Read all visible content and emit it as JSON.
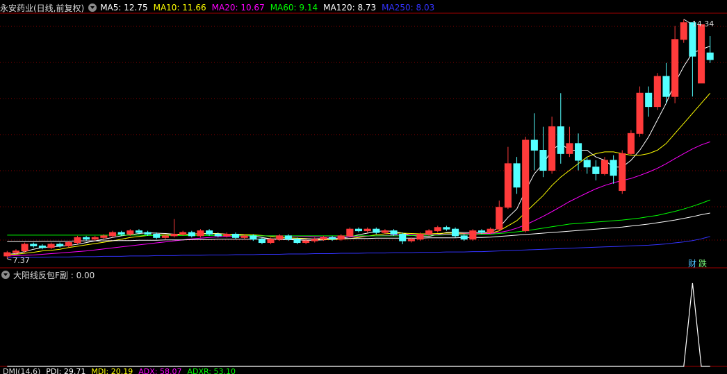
{
  "header": {
    "title": "永安药业(日线,前复权)",
    "ma": [
      {
        "label": "MA5: 12.75",
        "color": "#ffffff"
      },
      {
        "label": "MA10: 11.66",
        "color": "#ffff00"
      },
      {
        "label": "MA20: 10.67",
        "color": "#ff00ff"
      },
      {
        "label": "MA60: 9.14",
        "color": "#00ff00"
      },
      {
        "label": "MA120: 8.73",
        "color": "#ffffff"
      },
      {
        "label": "MA250: 8.03",
        "color": "#3333ff"
      }
    ]
  },
  "sub_header": {
    "title": "大阳线反包F副 : 0.00"
  },
  "bottom_header": {
    "labels": [
      "DMI(14,6)",
      "PDI: 29.71",
      "MDI: 20.19",
      "ADX: 58.07",
      "ADXR: 53.10"
    ]
  },
  "badges": {
    "cai": "财",
    "die": "跌"
  },
  "colors": {
    "up": "#ff3b3b",
    "down": "#54ffff",
    "grid": "#8b0000",
    "border": "#a00000"
  },
  "chart_data": [
    {
      "type": "candlestick",
      "title": "永安药业(日线,前复权)",
      "price_range": [
        7.2,
        14.6
      ],
      "high_label": "14.34",
      "low_label": "7.37",
      "candles": [
        [
          7.45,
          7.55,
          7.37,
          7.6
        ],
        [
          7.55,
          7.6,
          7.5,
          7.65
        ],
        [
          7.6,
          7.8,
          7.55,
          7.85
        ],
        [
          7.8,
          7.75,
          7.7,
          7.85
        ],
        [
          7.75,
          7.7,
          7.65,
          7.8
        ],
        [
          7.7,
          7.8,
          7.65,
          7.85
        ],
        [
          7.8,
          7.75,
          7.7,
          7.85
        ],
        [
          7.75,
          7.85,
          7.7,
          7.9
        ],
        [
          7.85,
          8.0,
          7.8,
          8.05
        ],
        [
          8.0,
          7.95,
          7.9,
          8.05
        ],
        [
          7.95,
          8.0,
          7.9,
          8.05
        ],
        [
          8.0,
          8.05,
          7.95,
          8.1
        ],
        [
          8.05,
          8.15,
          8.0,
          8.2
        ],
        [
          8.15,
          8.1,
          8.05,
          8.2
        ],
        [
          8.1,
          8.2,
          8.05,
          8.25
        ],
        [
          8.2,
          8.15,
          8.1,
          8.25
        ],
        [
          8.15,
          8.1,
          8.05,
          8.2
        ],
        [
          8.1,
          8.0,
          7.95,
          8.15
        ],
        [
          8.0,
          8.05,
          7.95,
          8.1
        ],
        [
          8.05,
          8.1,
          8.0,
          8.55
        ],
        [
          8.1,
          8.15,
          8.05,
          8.2
        ],
        [
          8.15,
          8.05,
          8.0,
          8.2
        ],
        [
          8.05,
          8.2,
          8.0,
          8.25
        ],
        [
          8.2,
          8.1,
          8.05,
          8.25
        ],
        [
          8.1,
          8.05,
          8.0,
          8.15
        ],
        [
          8.05,
          8.1,
          8.0,
          8.15
        ],
        [
          8.1,
          8.0,
          7.95,
          8.15
        ],
        [
          8.0,
          8.05,
          7.95,
          8.1
        ],
        [
          8.05,
          7.95,
          7.9,
          8.1
        ],
        [
          7.95,
          7.85,
          7.8,
          8.0
        ],
        [
          7.85,
          7.95,
          7.8,
          8.0
        ],
        [
          7.95,
          8.05,
          7.9,
          8.1
        ],
        [
          8.05,
          7.95,
          7.9,
          8.1
        ],
        [
          7.95,
          7.85,
          7.8,
          8.0
        ],
        [
          7.85,
          7.9,
          7.8,
          7.95
        ],
        [
          7.9,
          7.95,
          7.85,
          8.0
        ],
        [
          7.95,
          8.0,
          7.9,
          8.05
        ],
        [
          8.0,
          7.95,
          7.9,
          8.05
        ],
        [
          7.95,
          8.05,
          7.9,
          8.1
        ],
        [
          8.05,
          8.25,
          8.0,
          8.3
        ],
        [
          8.25,
          8.2,
          8.15,
          8.3
        ],
        [
          8.2,
          8.25,
          8.15,
          8.3
        ],
        [
          8.25,
          8.15,
          8.1,
          8.3
        ],
        [
          8.15,
          8.2,
          8.1,
          8.25
        ],
        [
          8.2,
          8.1,
          8.05,
          8.25
        ],
        [
          8.1,
          7.9,
          7.8,
          8.15
        ],
        [
          7.9,
          7.95,
          7.85,
          8.0
        ],
        [
          7.95,
          8.1,
          7.9,
          8.15
        ],
        [
          8.1,
          8.2,
          8.05,
          8.25
        ],
        [
          8.2,
          8.3,
          8.15,
          8.35
        ],
        [
          8.3,
          8.25,
          8.2,
          8.35
        ],
        [
          8.25,
          8.05,
          8.0,
          8.3
        ],
        [
          8.05,
          7.95,
          7.9,
          8.1
        ],
        [
          7.95,
          8.2,
          7.9,
          8.25
        ],
        [
          8.2,
          8.15,
          8.1,
          8.25
        ],
        [
          8.15,
          8.25,
          8.1,
          8.3
        ],
        [
          8.25,
          8.9,
          8.2,
          9.1
        ],
        [
          8.9,
          10.2,
          8.85,
          10.7
        ],
        [
          10.2,
          9.5,
          9.3,
          10.4
        ],
        [
          8.2,
          10.9,
          8.15,
          11.0
        ],
        [
          10.9,
          10.6,
          10.0,
          11.7
        ],
        [
          10.6,
          10.0,
          9.8,
          11.3
        ],
        [
          10.0,
          11.3,
          9.9,
          11.6
        ],
        [
          11.3,
          10.5,
          10.2,
          12.3
        ],
        [
          10.5,
          10.8,
          10.4,
          11.3
        ],
        [
          10.8,
          10.3,
          10.0,
          11.1
        ],
        [
          10.3,
          10.1,
          9.9,
          10.4
        ],
        [
          10.1,
          9.9,
          9.7,
          10.3
        ],
        [
          9.9,
          10.3,
          9.85,
          10.4
        ],
        [
          10.3,
          9.85,
          9.6,
          10.45
        ],
        [
          9.4,
          10.5,
          9.3,
          10.6
        ],
        [
          10.5,
          11.1,
          10.45,
          11.2
        ],
        [
          11.1,
          12.3,
          11.0,
          12.5
        ],
        [
          12.3,
          11.9,
          11.6,
          12.5
        ],
        [
          11.9,
          12.8,
          11.8,
          12.9
        ],
        [
          12.8,
          12.2,
          12.0,
          13.2
        ],
        [
          12.2,
          13.9,
          12.0,
          14.3
        ],
        [
          13.9,
          14.4,
          13.8,
          14.5
        ],
        [
          14.4,
          13.4,
          12.2,
          13.8
        ],
        [
          12.6,
          14.34,
          12.6,
          14.34
        ],
        [
          13.5,
          13.3,
          13.2,
          14.0
        ]
      ],
      "ma": [
        {
          "name": "MA5",
          "color": "#ffffff",
          "values": [
            7.5,
            7.52,
            7.58,
            7.65,
            7.7,
            7.72,
            7.74,
            7.76,
            7.8,
            7.85,
            7.9,
            7.95,
            8.0,
            8.05,
            8.08,
            8.12,
            8.14,
            8.13,
            8.12,
            8.1,
            8.1,
            8.1,
            8.12,
            8.12,
            8.12,
            8.1,
            8.08,
            8.06,
            8.04,
            8.0,
            7.96,
            7.94,
            7.94,
            7.93,
            7.92,
            7.92,
            7.93,
            7.95,
            7.98,
            8.02,
            8.08,
            8.13,
            8.18,
            8.2,
            8.18,
            8.13,
            8.07,
            8.03,
            8.03,
            8.09,
            8.15,
            8.16,
            8.15,
            8.14,
            8.15,
            8.16,
            8.3,
            8.6,
            8.85,
            9.4,
            9.9,
            10.2,
            10.6,
            10.8,
            10.6,
            10.6,
            10.6,
            10.4,
            10.3,
            10.1,
            10.1,
            10.3,
            10.6,
            11.0,
            11.5,
            12.0,
            12.6,
            13.1,
            13.5,
            13.6,
            13.7
          ]
        },
        {
          "name": "MA10",
          "color": "#ffff00",
          "values": [
            7.5,
            7.5,
            7.53,
            7.56,
            7.6,
            7.62,
            7.65,
            7.7,
            7.74,
            7.78,
            7.82,
            7.86,
            7.9,
            7.95,
            8.0,
            8.03,
            8.06,
            8.07,
            8.08,
            8.08,
            8.09,
            8.1,
            8.11,
            8.11,
            8.11,
            8.1,
            8.1,
            8.09,
            8.08,
            8.06,
            8.03,
            8.0,
            7.99,
            7.98,
            7.97,
            7.95,
            7.94,
            7.94,
            7.95,
            7.97,
            8.0,
            8.04,
            8.08,
            8.11,
            8.13,
            8.13,
            8.12,
            8.11,
            8.11,
            8.12,
            8.13,
            8.13,
            8.12,
            8.11,
            8.12,
            8.13,
            8.2,
            8.35,
            8.5,
            8.75,
            9.0,
            9.25,
            9.55,
            9.8,
            10.0,
            10.2,
            10.4,
            10.5,
            10.55,
            10.55,
            10.5,
            10.45,
            10.45,
            10.5,
            10.6,
            10.8,
            11.1,
            11.4,
            11.7,
            12.0,
            12.3
          ]
        },
        {
          "name": "MA20",
          "color": "#ff00ff",
          "values": [
            7.45,
            7.46,
            7.47,
            7.48,
            7.5,
            7.52,
            7.54,
            7.56,
            7.58,
            7.6,
            7.63,
            7.66,
            7.69,
            7.72,
            7.75,
            7.78,
            7.81,
            7.84,
            7.87,
            7.9,
            7.93,
            7.96,
            7.98,
            8.0,
            8.02,
            8.03,
            8.04,
            8.05,
            8.05,
            8.05,
            8.05,
            8.05,
            8.04,
            8.04,
            8.03,
            8.02,
            8.01,
            8.01,
            8.01,
            8.02,
            8.03,
            8.04,
            8.05,
            8.06,
            8.07,
            8.08,
            8.08,
            8.08,
            8.08,
            8.09,
            8.1,
            8.1,
            8.11,
            8.11,
            8.11,
            8.12,
            8.15,
            8.2,
            8.28,
            8.38,
            8.5,
            8.63,
            8.77,
            8.92,
            9.07,
            9.2,
            9.33,
            9.45,
            9.55,
            9.63,
            9.7,
            9.76,
            9.85,
            9.95,
            10.06,
            10.2,
            10.35,
            10.5,
            10.64,
            10.76,
            10.85
          ]
        },
        {
          "name": "MA60",
          "color": "#00ff00",
          "values": [
            8.07,
            8.07,
            8.07,
            8.07,
            8.07,
            8.07,
            8.07,
            8.07,
            8.07,
            8.07,
            8.07,
            8.07,
            8.07,
            8.07,
            8.07,
            8.07,
            8.06,
            8.06,
            8.06,
            8.06,
            8.06,
            8.06,
            8.06,
            8.06,
            8.06,
            8.06,
            8.06,
            8.06,
            8.06,
            8.05,
            8.05,
            8.05,
            8.05,
            8.05,
            8.05,
            8.05,
            8.05,
            8.05,
            8.05,
            8.05,
            8.05,
            8.05,
            8.05,
            8.05,
            8.05,
            8.05,
            8.06,
            8.06,
            8.07,
            8.07,
            8.08,
            8.08,
            8.09,
            8.09,
            8.1,
            8.1,
            8.12,
            8.14,
            8.17,
            8.2,
            8.24,
            8.28,
            8.32,
            8.36,
            8.4,
            8.42,
            8.44,
            8.46,
            8.48,
            8.5,
            8.52,
            8.55,
            8.58,
            8.62,
            8.66,
            8.72,
            8.78,
            8.85,
            8.93,
            9.02,
            9.12
          ]
        },
        {
          "name": "MA120",
          "color": "#ffffff",
          "values": [
            7.88,
            7.88,
            7.88,
            7.88,
            7.89,
            7.89,
            7.89,
            7.89,
            7.9,
            7.9,
            7.9,
            7.9,
            7.91,
            7.91,
            7.91,
            7.92,
            7.92,
            7.92,
            7.93,
            7.93,
            7.93,
            7.94,
            7.94,
            7.94,
            7.95,
            7.95,
            7.95,
            7.95,
            7.95,
            7.96,
            7.96,
            7.96,
            7.96,
            7.96,
            7.96,
            7.96,
            7.97,
            7.97,
            7.97,
            7.97,
            7.97,
            7.97,
            7.98,
            7.98,
            7.98,
            7.98,
            7.98,
            7.98,
            7.99,
            7.99,
            7.99,
            7.99,
            8.0,
            8.0,
            8.0,
            8.01,
            8.03,
            8.05,
            8.07,
            8.09,
            8.11,
            8.13,
            8.15,
            8.17,
            8.19,
            8.21,
            8.23,
            8.25,
            8.27,
            8.29,
            8.31,
            8.34,
            8.37,
            8.4,
            8.44,
            8.48,
            8.52,
            8.57,
            8.62,
            8.68,
            8.73
          ]
        },
        {
          "name": "MA250",
          "color": "#3333ff",
          "values": [
            7.4,
            7.4,
            7.41,
            7.41,
            7.41,
            7.42,
            7.42,
            7.42,
            7.43,
            7.43,
            7.43,
            7.44,
            7.44,
            7.44,
            7.45,
            7.45,
            7.45,
            7.46,
            7.46,
            7.46,
            7.47,
            7.47,
            7.47,
            7.48,
            7.48,
            7.48,
            7.49,
            7.49,
            7.49,
            7.5,
            7.5,
            7.5,
            7.51,
            7.51,
            7.51,
            7.52,
            7.52,
            7.52,
            7.53,
            7.53,
            7.53,
            7.54,
            7.54,
            7.54,
            7.55,
            7.55,
            7.55,
            7.56,
            7.56,
            7.56,
            7.57,
            7.57,
            7.57,
            7.58,
            7.58,
            7.59,
            7.6,
            7.61,
            7.62,
            7.63,
            7.64,
            7.65,
            7.66,
            7.67,
            7.68,
            7.69,
            7.7,
            7.71,
            7.72,
            7.73,
            7.74,
            7.75,
            7.76,
            7.77,
            7.79,
            7.81,
            7.84,
            7.87,
            7.91,
            7.96,
            8.03
          ]
        }
      ]
    },
    {
      "type": "line",
      "title": "大阳线反包F副 : 0.00",
      "ylim": [
        0,
        1
      ],
      "values": [
        0,
        0,
        0,
        0,
        0,
        0,
        0,
        0,
        0,
        0,
        0,
        0,
        0,
        0,
        0,
        0,
        0,
        0,
        0,
        0,
        0,
        0,
        0,
        0,
        0,
        0,
        0,
        0,
        0,
        0,
        0,
        0,
        0,
        0,
        0,
        0,
        0,
        0,
        0,
        0,
        0,
        0,
        0,
        0,
        0,
        0,
        0,
        0,
        0,
        0,
        0,
        0,
        0,
        0,
        0,
        0,
        0,
        0,
        0,
        0,
        0,
        0,
        0,
        0,
        0,
        0,
        0,
        0,
        0,
        0,
        0,
        0,
        0,
        0,
        0,
        0,
        0,
        0,
        1,
        0,
        0
      ]
    }
  ]
}
